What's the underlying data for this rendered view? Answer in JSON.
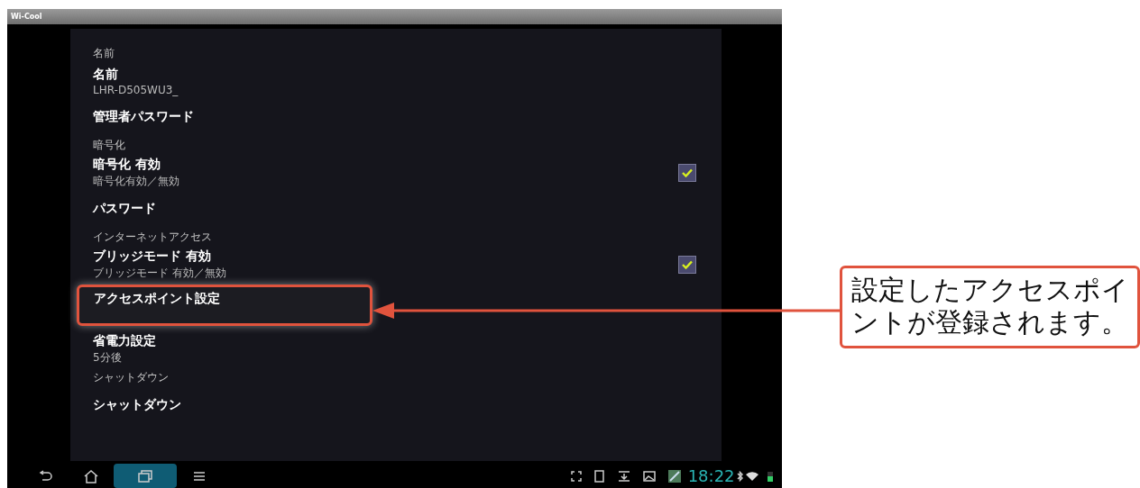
{
  "window": {
    "title": "Wi-Cool"
  },
  "settings": [
    {
      "kind": "header",
      "title": "名前"
    },
    {
      "kind": "item",
      "title": "名前",
      "summary": "LHR-D505WU3_",
      "highlighted": false
    },
    {
      "kind": "item",
      "title": "管理者パスワード",
      "highlighted": false
    },
    {
      "kind": "header",
      "title": "暗号化"
    },
    {
      "kind": "item",
      "title": "暗号化 有効",
      "summary": "暗号化有効／無効",
      "checked": true,
      "highlighted": false
    },
    {
      "kind": "item",
      "title": "パスワード",
      "highlighted": false
    },
    {
      "kind": "header",
      "title": "インターネットアクセス"
    },
    {
      "kind": "item",
      "title": "ブリッジモード 有効",
      "summary": "ブリッジモード 有効／無効",
      "checked": true,
      "highlighted": false
    },
    {
      "kind": "item",
      "title": "アクセスポイント設定",
      "highlighted": true
    },
    {
      "kind": "item",
      "title": "省電力設定",
      "summary": "5分後",
      "highlighted": false
    },
    {
      "kind": "header",
      "title": "シャットダウン"
    },
    {
      "kind": "item",
      "title": "シャットダウン",
      "highlighted": false
    }
  ],
  "status_bar": {
    "time": "18:22"
  },
  "callout": {
    "text": "設定したアクセスポイントが登録されます。"
  }
}
